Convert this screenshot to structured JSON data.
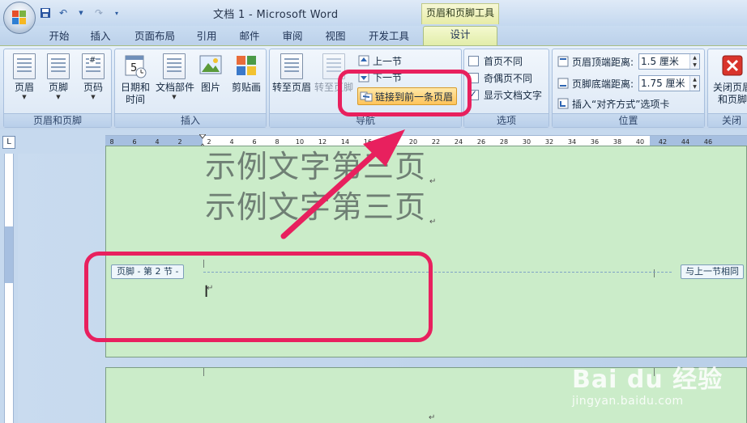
{
  "window": {
    "doc_title": "文档 1 - Microsoft Word",
    "context_title": "页眉和页脚工具"
  },
  "tabs": [
    {
      "label": "开始"
    },
    {
      "label": "插入"
    },
    {
      "label": "页面布局"
    },
    {
      "label": "引用"
    },
    {
      "label": "邮件"
    },
    {
      "label": "审阅"
    },
    {
      "label": "视图"
    },
    {
      "label": "开发工具"
    },
    {
      "label": "设计",
      "active": true
    }
  ],
  "ribbon": {
    "groups": {
      "header_footer": "页眉和页脚",
      "insert": "插入",
      "navigation": "导航",
      "options": "选项",
      "position": "位置",
      "close": "关闭"
    },
    "buttons": {
      "header": "页眉",
      "footer": "页脚",
      "page_number": "页码",
      "date_time_1": "日期和",
      "date_time_2": "时间",
      "doc_parts": "文档部件",
      "picture": "图片",
      "clip_art": "剪贴画",
      "goto_header": "转至页眉",
      "goto_footer": "转至页脚",
      "prev_section": "上一节",
      "next_section": "下一节",
      "link_previous": "链接到前一条页眉",
      "close_1": "关闭页眉",
      "close_2": "和页脚"
    },
    "options": {
      "different_first": "首页不同",
      "different_odd_even": "奇偶页不同",
      "show_doc_text": "显示文档文字"
    },
    "position": {
      "header_from_top_label": "页眉顶端距离:",
      "header_from_top_value": "1.5 厘米",
      "footer_from_bottom_label": "页脚底端距离:",
      "footer_from_bottom_value": "1.75 厘米",
      "insert_align_tab": "插入“对齐方式”选项卡"
    }
  },
  "ruler": {
    "corner": "L",
    "ticks": [
      "8",
      "6",
      "4",
      "2",
      "2",
      "4",
      "6",
      "8",
      "10",
      "12",
      "14",
      "16",
      "18",
      "20",
      "22",
      "24",
      "26",
      "28",
      "30",
      "32",
      "34",
      "36",
      "38",
      "40",
      "42",
      "44",
      "46"
    ]
  },
  "document": {
    "line1": "示例文字第三页",
    "line2": "示例文字第三页",
    "footer_tag": "页脚 - 第 2 节 -",
    "same_as_previous": "与上一节相同",
    "para_mark": "↵"
  },
  "watermark": {
    "main": "Bai du 经验",
    "sub": "jingyan.baidu.com"
  },
  "colors": {
    "annotation": "#e8205e",
    "page": "#cbecc9",
    "context_tab": "#e7eca6"
  }
}
